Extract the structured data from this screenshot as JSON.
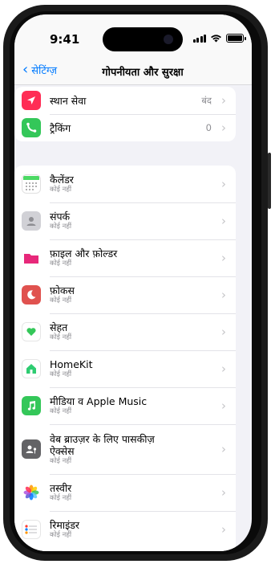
{
  "status": {
    "time": "9:41"
  },
  "nav": {
    "back_label": "सेटिंग्ज़",
    "title": "गोपनीयता और सुरक्षा"
  },
  "section1": [
    {
      "label": "स्थान सेवा",
      "value": "बंद",
      "icon": "location-arrow-icon",
      "color": "#ff2d55"
    },
    {
      "label": "ट्रैकिंग",
      "value": "0",
      "icon": "tracking-icon",
      "color": "#34c759"
    }
  ],
  "section2": [
    {
      "label": "कैलेंडर",
      "sub": "कोई नहीं",
      "icon": "calendar-icon"
    },
    {
      "label": "संपर्क",
      "sub": "कोई नहीं",
      "icon": "contacts-icon"
    },
    {
      "label": "फ़ाइल और फ़ोल्डर",
      "sub": "कोई नहीं",
      "icon": "folder-icon",
      "color": "#e7287a"
    },
    {
      "label": "फ़ोकस",
      "sub": "कोई नहीं",
      "icon": "focus-moon-icon",
      "color": "#e0524f"
    },
    {
      "label": "सेहत",
      "sub": "कोई नहीं",
      "icon": "health-heart-icon",
      "color": "#34c759"
    },
    {
      "label": "HomeKit",
      "sub": "कोई नहीं",
      "icon": "homekit-icon",
      "color": "#2ecc71"
    },
    {
      "label": "मीडिया व Apple Music",
      "sub": "कोई नहीं",
      "icon": "music-icon",
      "color": "#34c759"
    },
    {
      "label": "वेब ब्राउज़र के लिए पासकीज़ ऐक्सेस",
      "sub": "कोई नहीं",
      "icon": "passkey-icon",
      "color": "#636366"
    },
    {
      "label": "तस्वीर",
      "sub": "कोई नहीं",
      "icon": "photos-icon"
    },
    {
      "label": "रिमाइंडर",
      "sub": "कोई नहीं",
      "icon": "reminders-icon"
    }
  ]
}
